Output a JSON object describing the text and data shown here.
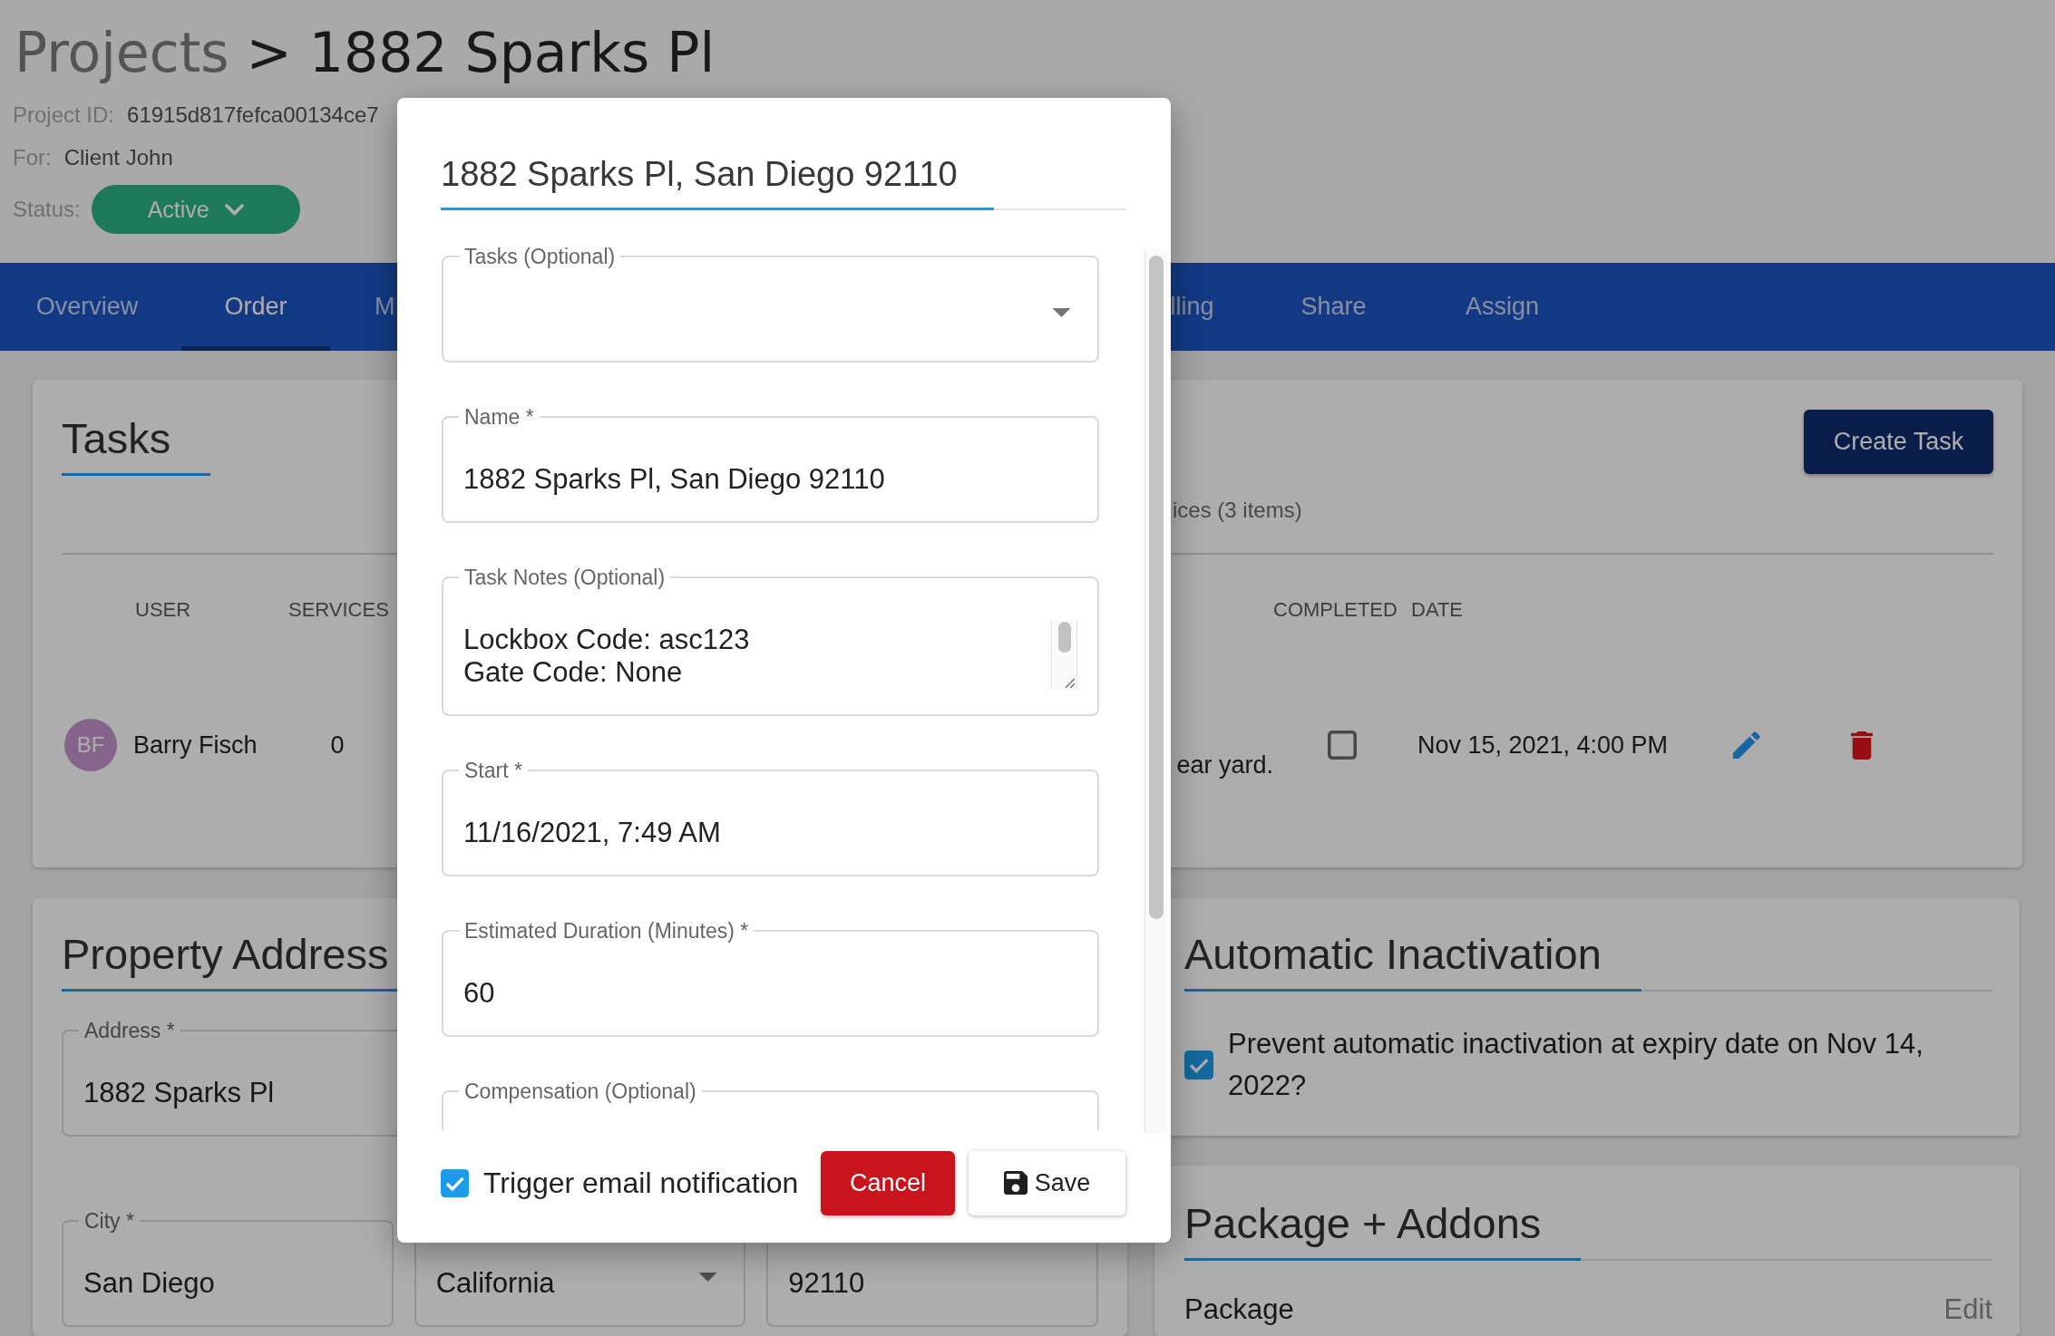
{
  "header": {
    "breadcrumb": "Projects",
    "separator": ">",
    "title": "1882 Sparks Pl",
    "meta": [
      {
        "label": "Project ID:",
        "value": "61915d817fefca00134ce7"
      },
      {
        "label": "For:",
        "value": "Client John"
      }
    ],
    "status": {
      "label": "Status:",
      "value": "Active"
    }
  },
  "tabs": [
    {
      "label": "Overview",
      "selected": false,
      "kind": "full"
    },
    {
      "label": "Order",
      "selected": true,
      "kind": "full"
    },
    {
      "label": "M",
      "selected": false,
      "kind": "clipped_right"
    },
    {
      "label": "lling",
      "selected": false,
      "kind": "clipped_left"
    },
    {
      "label": "Share",
      "selected": false,
      "kind": "full"
    },
    {
      "label": "Assign",
      "selected": false,
      "kind": "full"
    }
  ],
  "tasks": {
    "title": "Tasks",
    "create_button": "Create Task",
    "summary": "ices (3 items)",
    "columns": [
      "USER",
      "SERVICES",
      "COMPLETED",
      "DATE"
    ],
    "rows": [
      {
        "initials": "BF",
        "user": "Barry Fisch",
        "services": "0",
        "notes": "ear yard.",
        "completed": false,
        "date": "Nov 15, 2021, 4:00 PM"
      }
    ]
  },
  "property_address": {
    "title": "Property Address",
    "rows": [
      [
        {
          "kind": "text",
          "label": "Address *",
          "value": "1882 Sparks Pl"
        }
      ],
      [
        {
          "kind": "text",
          "label": "City *",
          "value": "San Diego"
        },
        {
          "kind": "select",
          "value": "California"
        },
        {
          "kind": "text",
          "value": "92110"
        }
      ]
    ]
  },
  "automatic_inactivation": {
    "title": "Automatic Inactivation",
    "checked": true,
    "text": "Prevent automatic inactivation at expiry date on Nov 14, 2022?"
  },
  "package_addons": {
    "title": "Package + Addons",
    "label": "Package",
    "action": "Edit"
  },
  "dialog": {
    "title": "1882 Sparks Pl, San Diego 92110",
    "fields": [
      {
        "kind": "select",
        "label": "Tasks (Optional)"
      },
      {
        "kind": "text",
        "label": "Name *",
        "value": "1882 Sparks Pl, San Diego 92110"
      },
      {
        "kind": "textarea",
        "label": "Task Notes (Optional)",
        "lines": [
          "Lockbox Code: asc123",
          "Gate Code: None"
        ]
      },
      {
        "kind": "text",
        "label": "Start *",
        "value": "11/16/2021, 7:49 AM"
      },
      {
        "kind": "text",
        "label": "Estimated Duration (Minutes) *",
        "value": "60"
      },
      {
        "kind": "text",
        "label": "Compensation (Optional)"
      }
    ],
    "notify": {
      "label": "Trigger email notification",
      "checked": true
    },
    "cancel_button": "Cancel",
    "save_button": "Save"
  }
}
